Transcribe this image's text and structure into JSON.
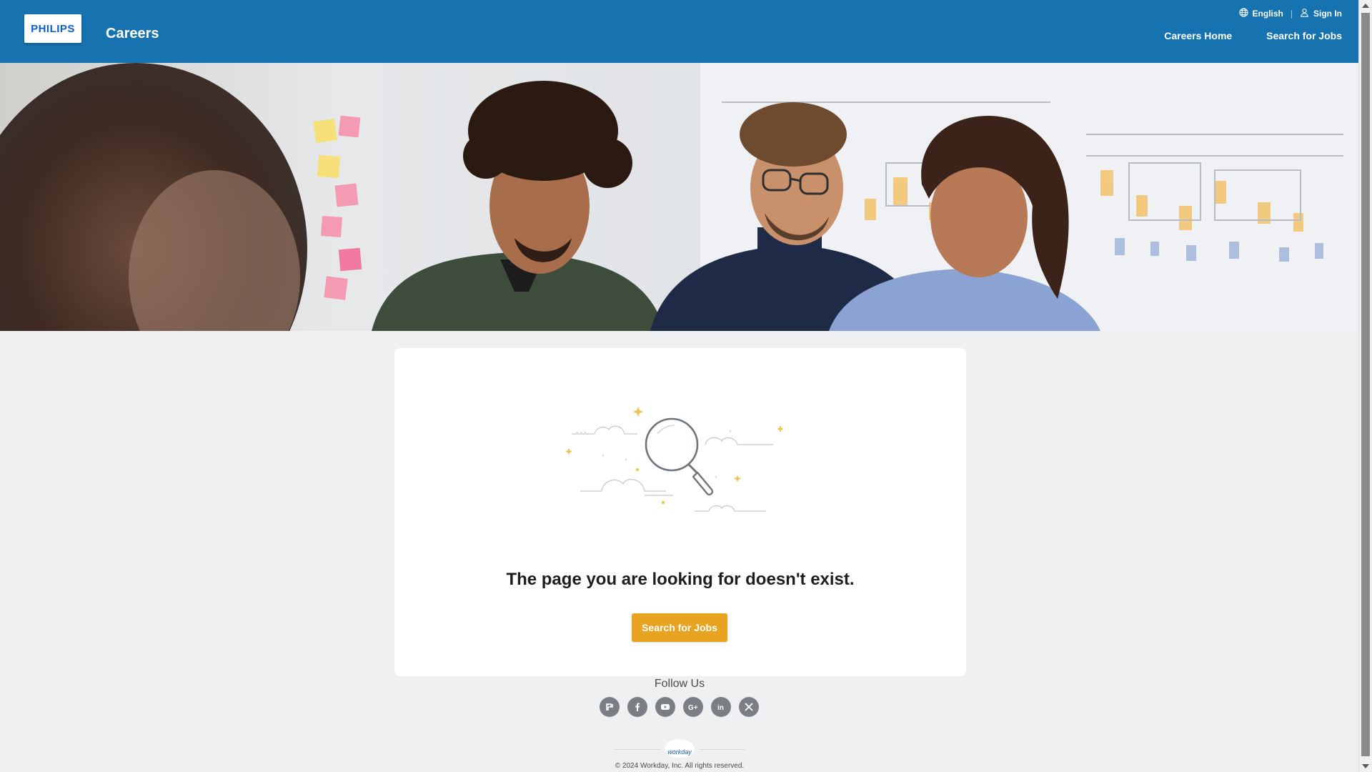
{
  "header": {
    "logo_text": "PHILIPS",
    "site_title": "Careers",
    "language": "English",
    "sign_in": "Sign In",
    "nav": {
      "careers_home": "Careers Home",
      "search_for_jobs": "Search for Jobs"
    }
  },
  "main": {
    "error_title": "The page you are looking for doesn't exist.",
    "search_button": "Search for Jobs"
  },
  "footer": {
    "follow_us": "Follow Us",
    "social": [
      "glassdoor-icon",
      "facebook-icon",
      "youtube-icon",
      "google-plus-icon",
      "linkedin-icon",
      "x-icon"
    ],
    "workday_logo_text": "workday",
    "copyright": "© 2024 Workday, Inc. All rights reserved."
  },
  "colors": {
    "header_bg": "#1673b0",
    "accent_button": "#e8a320",
    "page_bg": "#eff0f2",
    "social_icon_bg": "#7b7f85"
  }
}
